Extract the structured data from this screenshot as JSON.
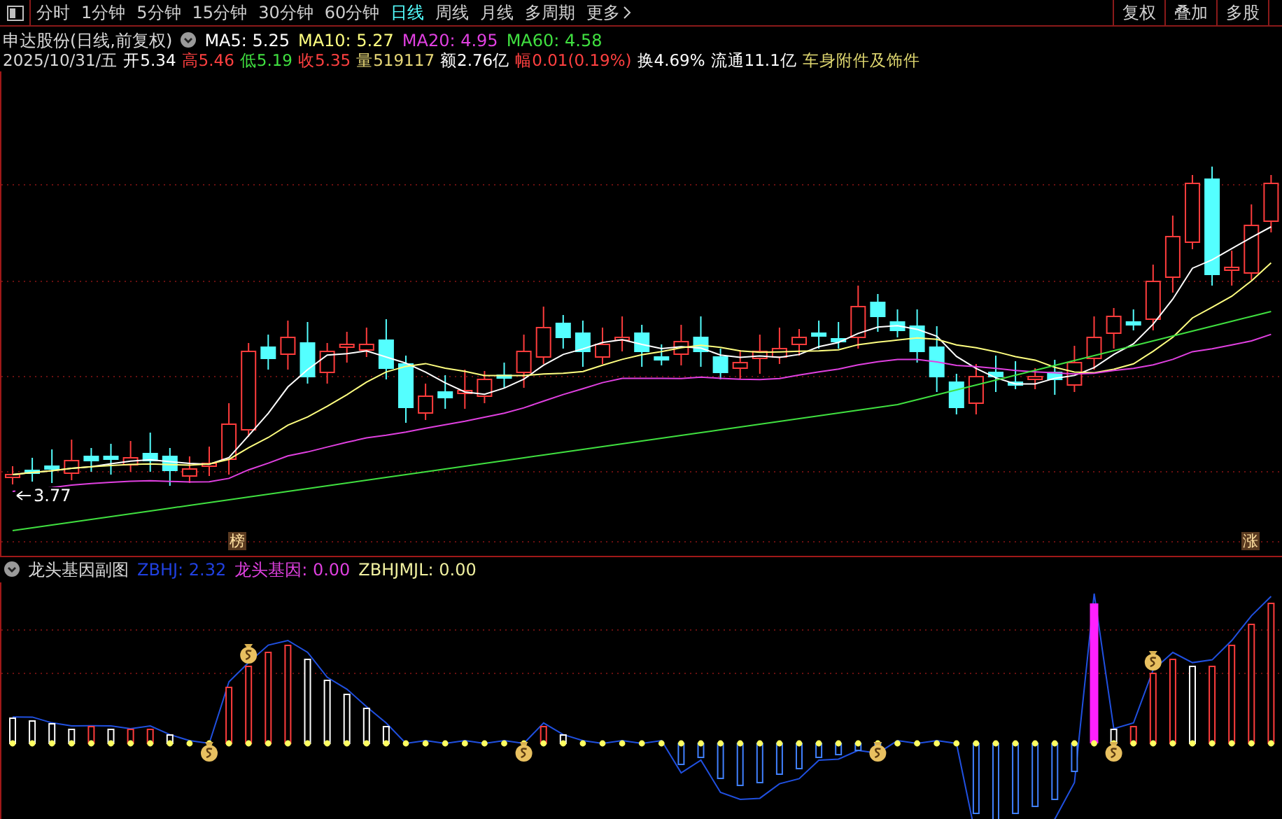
{
  "toolbar": {
    "tabs": [
      {
        "label": "分时",
        "selected": false
      },
      {
        "label": "1分钟",
        "selected": false
      },
      {
        "label": "5分钟",
        "selected": false
      },
      {
        "label": "15分钟",
        "selected": false
      },
      {
        "label": "30分钟",
        "selected": false
      },
      {
        "label": "60分钟",
        "selected": false
      },
      {
        "label": "日线",
        "selected": true
      },
      {
        "label": "周线",
        "selected": false
      },
      {
        "label": "月线",
        "selected": false
      },
      {
        "label": "多周期",
        "selected": false
      }
    ],
    "more": "更多",
    "right_buttons": [
      "复权",
      "叠加",
      "多股"
    ]
  },
  "quote": {
    "title": "申达股份(日线,前复权)",
    "ma": [
      {
        "label": "MA5: 5.25",
        "color": "#ffffff"
      },
      {
        "label": "MA10: 5.27",
        "color": "#ffff80"
      },
      {
        "label": "MA20: 4.95",
        "color": "#e040e0"
      },
      {
        "label": "MA60: 4.58",
        "color": "#40e040"
      }
    ],
    "date": "2025/10/31/五",
    "fields": [
      {
        "label": "开",
        "value": "5.34",
        "color": "#ffffff"
      },
      {
        "label": "高",
        "value": "5.46",
        "color": "#ff4040"
      },
      {
        "label": "低",
        "value": "5.19",
        "color": "#40e040"
      },
      {
        "label": "收",
        "value": "5.35",
        "color": "#ff4040"
      },
      {
        "label": "量",
        "value": "519117",
        "color": "#e8d878"
      },
      {
        "label": "额",
        "value": "2.76亿",
        "color": "#ffffff"
      },
      {
        "label": "幅",
        "value": "0.01(0.19%)",
        "color": "#ff4040"
      },
      {
        "label": "换",
        "value": "4.69%",
        "color": "#ffffff"
      },
      {
        "label": "流通",
        "value": "11.1亿",
        "color": "#ffffff"
      }
    ],
    "sector": "车身附件及饰件"
  },
  "main_chart": {
    "low_label": "3.77",
    "badges": [
      "榜",
      "涨"
    ]
  },
  "sub_chart": {
    "title": "龙头基因副图",
    "indicators": [
      {
        "label": "ZBHJ: 2.32",
        "color": "#2040e0"
      },
      {
        "label": "龙头基因: 0.00",
        "color": "#e040e0"
      },
      {
        "label": "ZBHJMJL: 0.00",
        "color": "#f0f0a0"
      }
    ]
  }
}
